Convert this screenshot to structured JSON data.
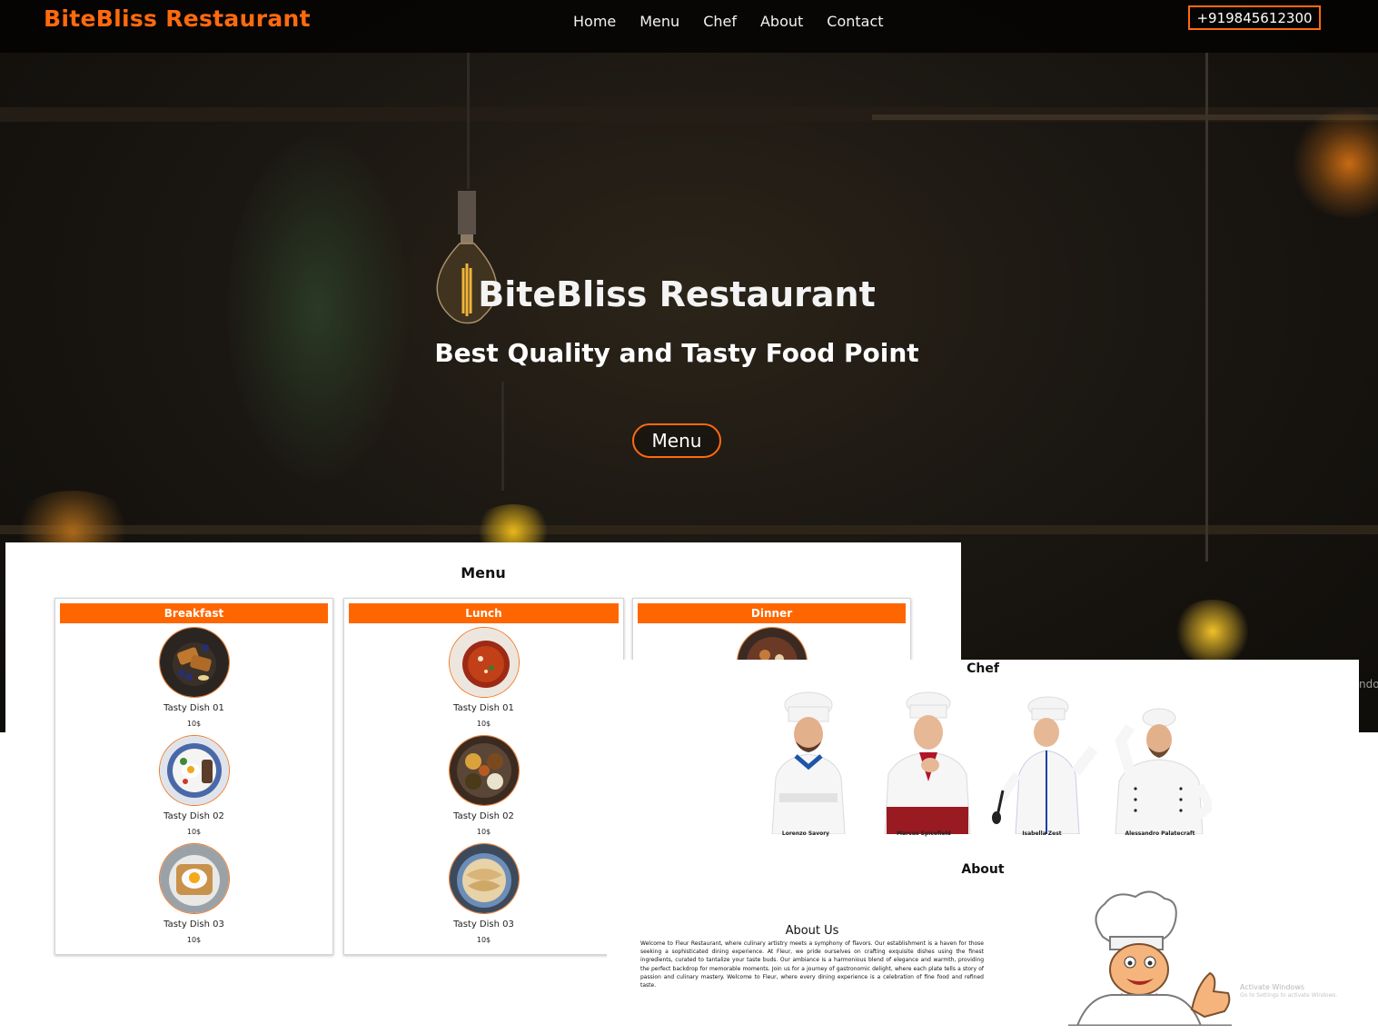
{
  "header": {
    "brand": "BiteBliss Restaurant",
    "nav": [
      "Home",
      "Menu",
      "Chef",
      "About",
      "Contact"
    ],
    "phone": "+919845612300"
  },
  "hero": {
    "title": "BiteBliss Restaurant",
    "subtitle": "Best Quality and Tasty Food Point",
    "button": "Menu"
  },
  "menu": {
    "title": "Menu",
    "categories": [
      {
        "name": "Breakfast",
        "dishes": [
          {
            "name": "Tasty Dish 01",
            "price": "10$"
          },
          {
            "name": "Tasty Dish 02",
            "price": "10$"
          },
          {
            "name": "Tasty Dish 03",
            "price": "10$"
          }
        ]
      },
      {
        "name": "Lunch",
        "dishes": [
          {
            "name": "Tasty Dish 01",
            "price": "10$"
          },
          {
            "name": "Tasty Dish 02",
            "price": "10$"
          },
          {
            "name": "Tasty Dish 03",
            "price": "10$"
          }
        ]
      },
      {
        "name": "Dinner",
        "dishes": []
      }
    ]
  },
  "chef": {
    "title": "Chef",
    "members": [
      "Lorenzo Savory",
      "Marcus Spicefield",
      "Isabella Zest",
      "Alessandro Palatecraft"
    ]
  },
  "about": {
    "title": "About",
    "subtitle": "About Us",
    "text": "Welcome to Fleur Restaurant, where culinary artistry meets a symphony of flavors. Our establishment is a haven for those seeking a sophisticated dining experience. At Fleur, we pride ourselves on crafting exquisite dishes using the finest ingredients, curated to tantalize your taste buds. Our ambiance is a harmonious blend of elegance and warmth, providing the perfect backdrop for memorable moments. Join us for a journey of gastronomic delight, where each plate tells a story of passion and culinary mastery. Welcome to Fleur, where every dining experience is a celebration of fine food and refined taste."
  },
  "system": {
    "activate_title": "Activate Windows",
    "activate_hint": "Go to Settings to activate Windows.",
    "edge_text": "ndo"
  },
  "colors": {
    "accent": "#ff6a0e",
    "hero_bg": "#1b1712",
    "panel_bg": "#ffffff"
  }
}
